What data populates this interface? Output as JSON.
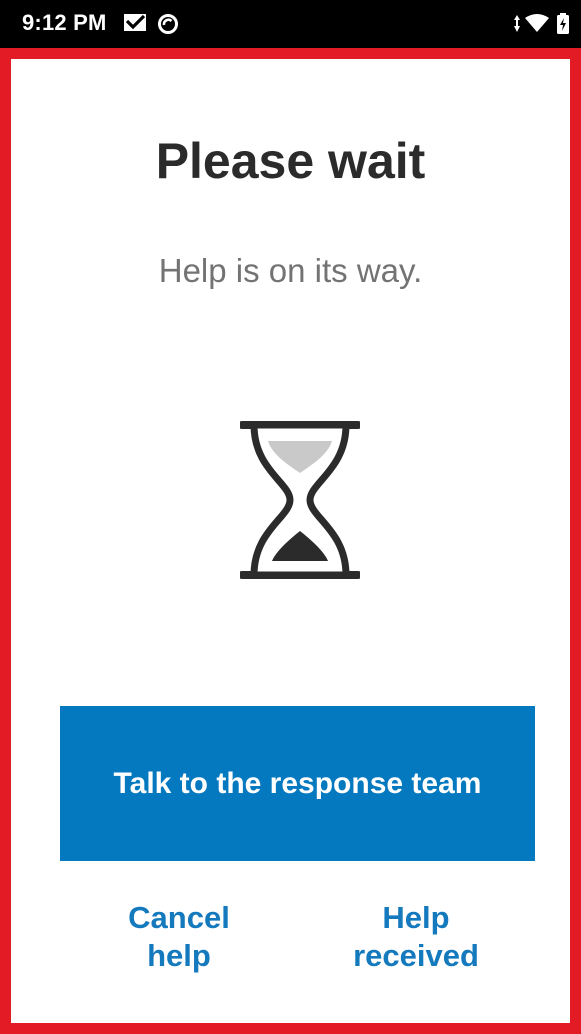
{
  "status_bar": {
    "time": "9:12 PM",
    "icons": [
      "mail-check-icon",
      "sync-icon",
      "data-arrows-icon",
      "wifi-icon",
      "battery-icon"
    ]
  },
  "screen": {
    "title": "Please wait",
    "subtitle": "Help is on its way.",
    "illustration": "hourglass-icon",
    "primary_button_label": "Talk to the response team",
    "cancel_help": {
      "line1": "Cancel",
      "line2": "help"
    },
    "help_received": {
      "line1": "Help",
      "line2": "received"
    }
  },
  "colors": {
    "frame_border": "#e21b24",
    "primary_button": "#0479bf",
    "link": "#1479bd",
    "title": "#2b2b2b",
    "subtitle": "#737373"
  }
}
